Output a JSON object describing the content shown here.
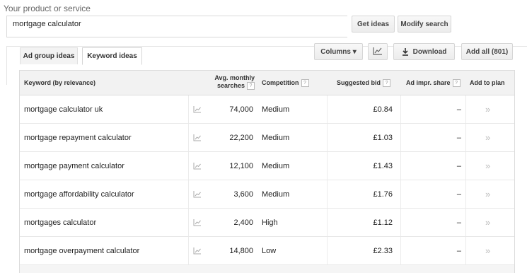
{
  "search": {
    "label": "Your product or service",
    "value": "mortgage calculator",
    "get_ideas_label": "Get ideas",
    "modify_label": "Modify search"
  },
  "tabs": [
    {
      "label": "Ad group ideas"
    },
    {
      "label": "Keyword ideas"
    }
  ],
  "toolbar": {
    "columns_label": "Columns ▾",
    "chart_icon": "line-chart-icon",
    "download_label": "Download",
    "download_icon": "download-icon",
    "add_all_label": "Add all (801)"
  },
  "table": {
    "headers": {
      "keyword": "Keyword (by relevance)",
      "searches_line1": "Avg. monthly",
      "searches_line2": "searches",
      "competition": "Competition",
      "bid": "Suggested bid",
      "impr": "Ad impr. share",
      "add": "Add to plan",
      "help": "?"
    },
    "rows": [
      {
        "keyword": "mortgage calculator uk",
        "searches": "74,000",
        "competition": "Medium",
        "bid": "£0.84",
        "impr": "–",
        "add": "»"
      },
      {
        "keyword": "mortgage repayment calculator",
        "searches": "22,200",
        "competition": "Medium",
        "bid": "£1.03",
        "impr": "–",
        "add": "»"
      },
      {
        "keyword": "mortgage payment calculator",
        "searches": "12,100",
        "competition": "Medium",
        "bid": "£1.43",
        "impr": "–",
        "add": "»"
      },
      {
        "keyword": "mortgage affordability calculator",
        "searches": "3,600",
        "competition": "Medium",
        "bid": "£1.76",
        "impr": "–",
        "add": "»"
      },
      {
        "keyword": "mortgages calculator",
        "searches": "2,400",
        "competition": "High",
        "bid": "£1.12",
        "impr": "–",
        "add": "»"
      },
      {
        "keyword": "mortgage overpayment calculator",
        "searches": "14,800",
        "competition": "Low",
        "bid": "£2.33",
        "impr": "–",
        "add": "»"
      }
    ]
  }
}
